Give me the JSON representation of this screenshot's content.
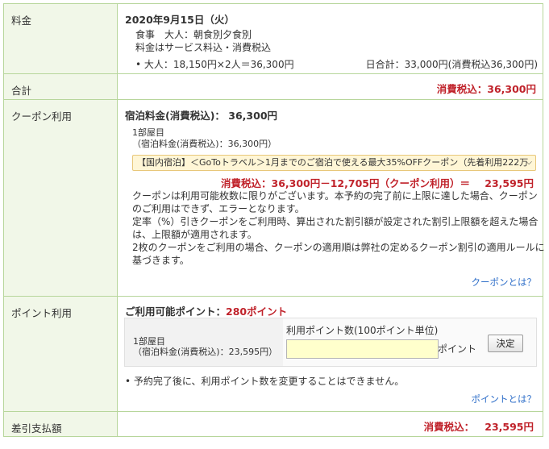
{
  "rows": {
    "fee": {
      "label": "料金",
      "date": "2020年9月15日（火）",
      "meal": "食事　大人：朝食別夕食別",
      "tax_note": "料金はサービス料込・消費税込",
      "breakdown": "大人：18,150円×2人＝36,300円",
      "daily_total": "日合計：33,000円(消費税込36,300円)"
    },
    "total": {
      "label": "合計",
      "value": "消費税込：36,300円"
    },
    "coupon": {
      "label": "クーポン利用",
      "lodging_fee": "宿泊料金(消費税込)：  36,300円",
      "room": "1部屋目",
      "room_fee": "（宿泊料金(消費税込)：36,300円）",
      "selected_coupon": "【国内宿泊】＜GoToトラベル＞1月までのご宿泊で使える最大35%OFFクーポン（先着利用222万",
      "calc": "消費税込：36,300円－12,705円（クーポン利用）＝",
      "calc_result": "23,595円",
      "notes": [
        "クーポンは利用可能枚数に限りがございます。本予約の完了前に上限に達した場合、クーポン",
        "のご利用はできず、エラーとなります。",
        "定率（%）引きクーポンをご利用時、算出された割引額が設定された割引上限額を超えた場合",
        "は、上限額が適用されます。",
        "2枚のクーポンをご利用の場合、クーポンの適用順は弊社の定めるクーポン割引の適用ルールに",
        "基づきます。"
      ],
      "link": "クーポンとは？"
    },
    "points": {
      "label": "ポイント利用",
      "available_label": "ご利用可能ポイント：",
      "available_value": "280ポイント",
      "room": "1部屋目",
      "room_fee": "（宿泊料金(消費税込)：23,595円）",
      "input_label": "利用ポイント数(100ポイント単位)",
      "input_value": "",
      "unit": "ポイント",
      "apply_button": "決定",
      "note": "予約完了後に、利用ポイント数を変更することはできません。",
      "link": "ポイントとは？"
    },
    "balance": {
      "label": "差引支払額",
      "tax_label": "消費税込：",
      "value": "23,595円"
    }
  }
}
